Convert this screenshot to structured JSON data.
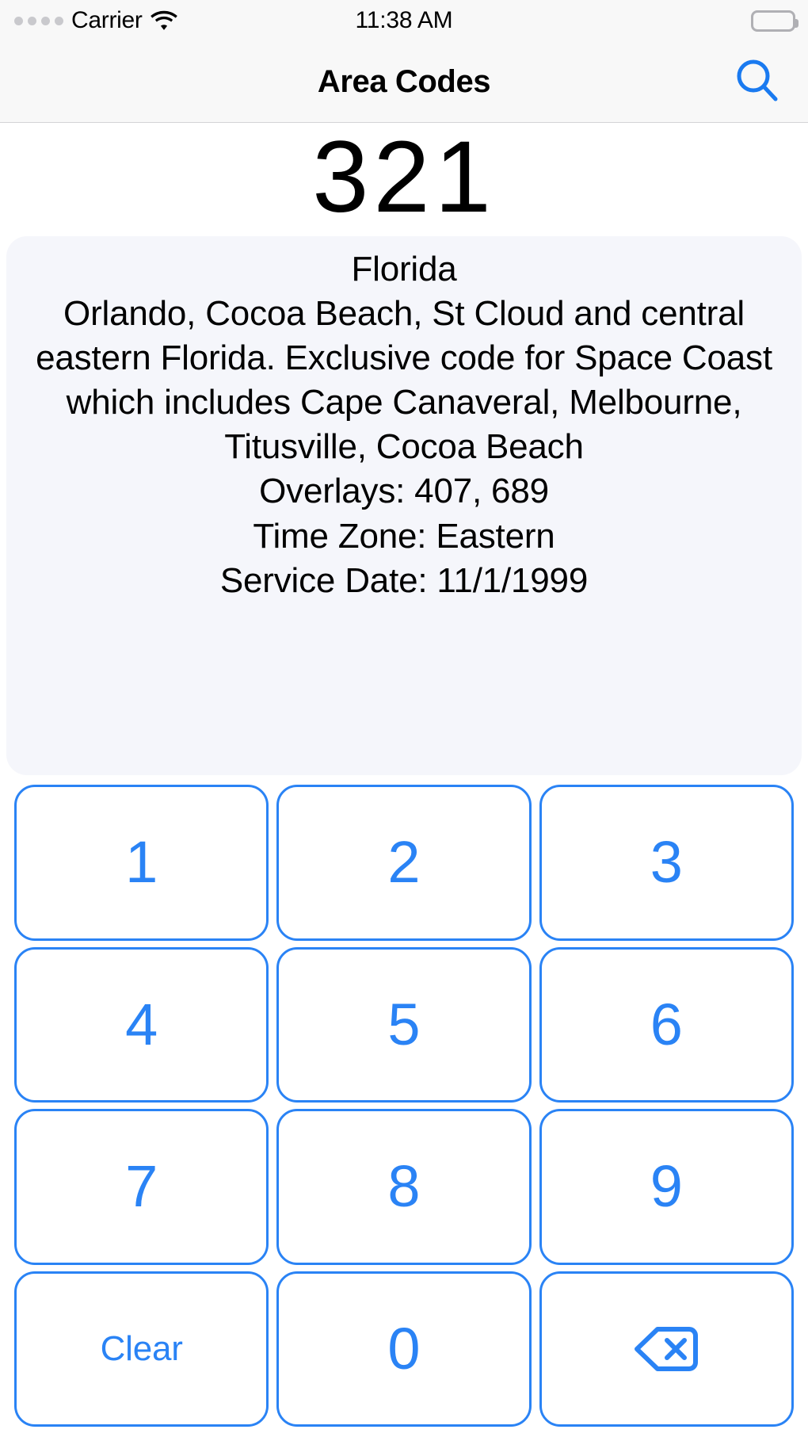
{
  "status_bar": {
    "signal_icon": "signal-dots-icon",
    "signal_dots": 4,
    "carrier": "Carrier",
    "wifi_icon": "wifi-icon",
    "time": "11:38 AM",
    "battery_icon": "battery-full-icon"
  },
  "nav_bar": {
    "title": "Area Codes",
    "search_icon": "search-icon"
  },
  "display": {
    "area_code": "321"
  },
  "info": {
    "lines": [
      "Florida",
      "Orlando, Cocoa Beach, St Cloud and central eastern Florida. Exclusive code for Space Coast which includes Cape Canaveral, Melbourne, Titusville, Cocoa Beach",
      "Overlays: 407, 689",
      "Time Zone: Eastern",
      "Service Date: 11/1/1999"
    ],
    "state": "Florida",
    "description": "Orlando, Cocoa Beach, St Cloud and central eastern Florida. Exclusive code for Space Coast which includes Cape Canaveral, Melbourne, Titusville, Cocoa Beach",
    "overlays": "Overlays: 407, 689",
    "time_zone": "Time Zone: Eastern",
    "service_date": "Service Date: 11/1/1999"
  },
  "keypad": {
    "keys": [
      {
        "label": "1",
        "name": "key-1",
        "type": "digit"
      },
      {
        "label": "2",
        "name": "key-2",
        "type": "digit"
      },
      {
        "label": "3",
        "name": "key-3",
        "type": "digit"
      },
      {
        "label": "4",
        "name": "key-4",
        "type": "digit"
      },
      {
        "label": "5",
        "name": "key-5",
        "type": "digit"
      },
      {
        "label": "6",
        "name": "key-6",
        "type": "digit"
      },
      {
        "label": "7",
        "name": "key-7",
        "type": "digit"
      },
      {
        "label": "8",
        "name": "key-8",
        "type": "digit"
      },
      {
        "label": "9",
        "name": "key-9",
        "type": "digit"
      },
      {
        "label": "Clear",
        "name": "key-clear",
        "type": "word"
      },
      {
        "label": "0",
        "name": "key-0",
        "type": "digit"
      },
      {
        "label": "",
        "name": "key-backspace",
        "type": "backspace-icon"
      }
    ]
  },
  "colors": {
    "accent_blue": "#2a83f5",
    "search_blue": "#1a7af0",
    "panel_bg": "#f5f6fb",
    "bar_bg": "#f8f8f8",
    "text_black": "#000000",
    "dot_gray": "#c9c9cd"
  }
}
